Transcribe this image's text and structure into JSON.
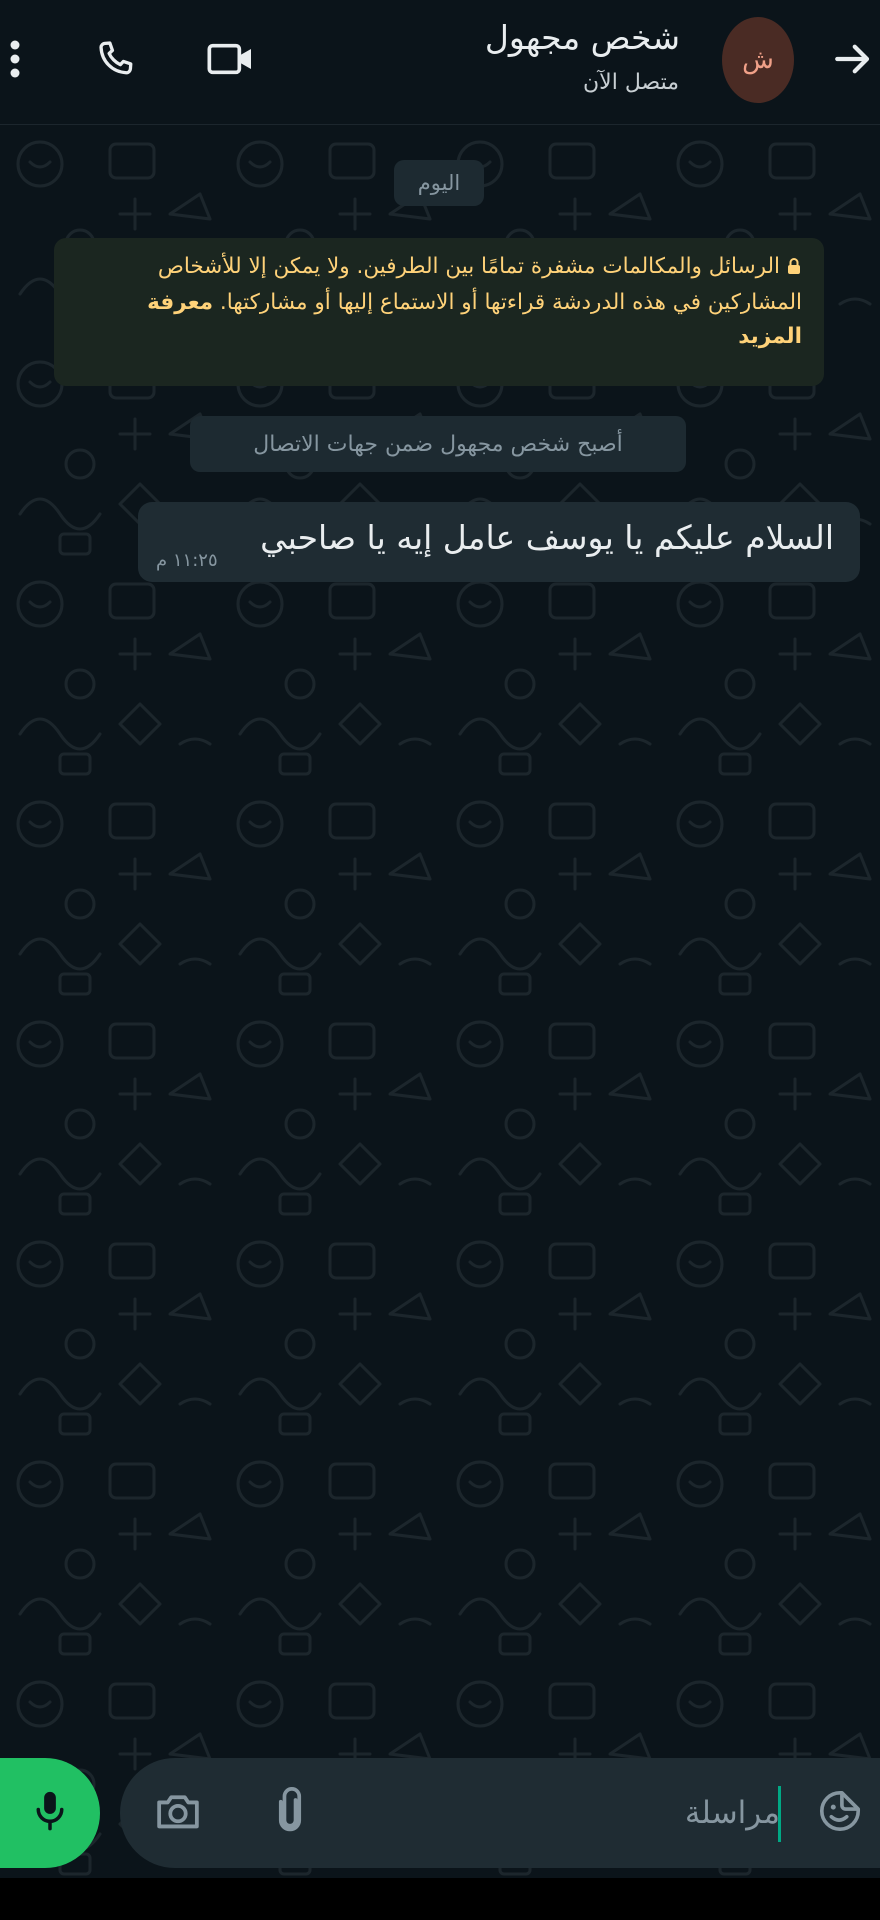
{
  "header": {
    "contact_name": "شخص مجهول",
    "status": "متصل الآن",
    "avatar_letter": "ش"
  },
  "chat": {
    "date_chip": "اليوم",
    "encryption_notice": "الرسائل والمكالمات مشفرة تمامًا بين الطرفين. ولا يمكن إلا للأشخاص المشاركين في هذه الدردشة قراءتها أو الاستماع إليها أو مشاركتها.",
    "encryption_learn_more": "معرفة المزيد",
    "system_message": "أصبح شخص مجهول ضمن جهات الاتصال",
    "messages": [
      {
        "text": "السلام عليكم يا يوسف عامل إيه يا صاحبي",
        "time": "١١:٢٥ م"
      }
    ]
  },
  "composer": {
    "placeholder": "مراسلة"
  },
  "colors": {
    "background": "#0b141a",
    "bubble": "#1f2c33",
    "accent_green": "#21c063",
    "notice_text": "#ffd279"
  },
  "icons": [
    "menu-icon",
    "phone-icon",
    "video-icon",
    "back-arrow-icon",
    "lock-icon",
    "mic-icon",
    "camera-icon",
    "attach-icon",
    "sticker-icon"
  ]
}
